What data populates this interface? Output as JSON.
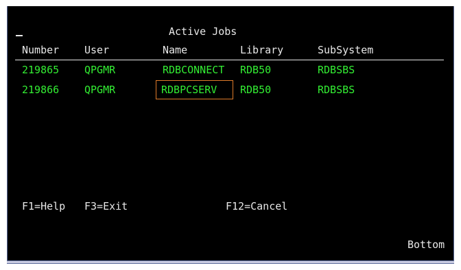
{
  "screen": {
    "title": "Active Jobs",
    "columns": [
      "Number",
      "User",
      "Name",
      "Library",
      "SubSystem"
    ],
    "rows": [
      {
        "number": "219865",
        "user": "QPGMR",
        "name": "RDBCONNECT",
        "library": "RDB50",
        "subsystem": "RDBSBS"
      },
      {
        "number": "219866",
        "user": "QPGMR",
        "name": "RDBPCSERV",
        "library": "RDB50",
        "subsystem": "RDBSBS"
      }
    ],
    "function_keys": {
      "help": "F1=Help",
      "exit": "F3=Exit",
      "cancel": "F12=Cancel"
    },
    "status": "Bottom"
  },
  "colors": {
    "background": "#000000",
    "text": "#e8e8e8",
    "data_text": "#33ee33",
    "selection_border": "#e07b2a"
  }
}
